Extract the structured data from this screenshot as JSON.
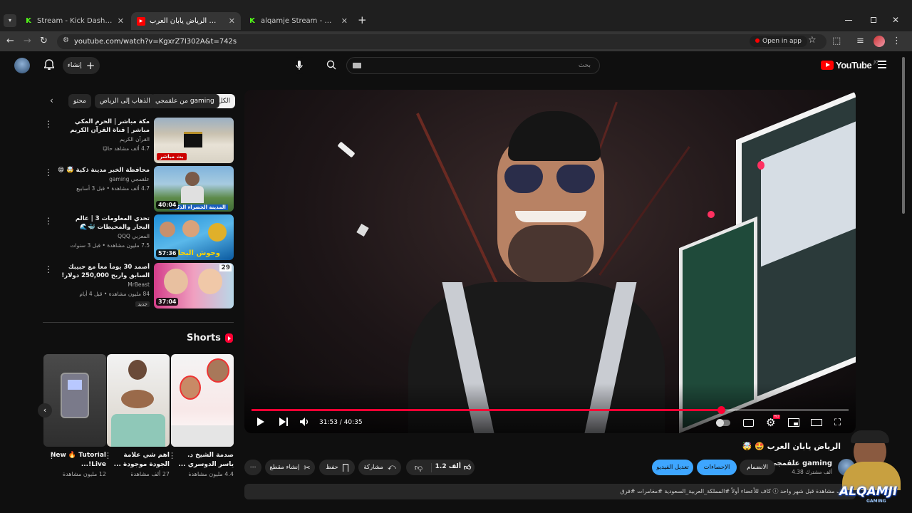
{
  "browser": {
    "tabs": [
      {
        "title": "Stream - Kick Dashboard",
        "favicon": "K",
        "color": "#53fc18",
        "active": false
      },
      {
        "title": "الرياض يابان العرب 🤩 🤯 - YouTube",
        "favicon": "▶",
        "color": "#ff0000",
        "active": true
      },
      {
        "title": "alqamje Stream - Watch Live o",
        "favicon": "K",
        "color": "#53fc18",
        "active": false
      }
    ],
    "new_tab": "+",
    "url": "youtube.com/watch?v=KgxrZ7I302A&t=742s",
    "open_in_app": "Open in app"
  },
  "header": {
    "create_label": "إنشاء",
    "search_placeholder": "بحث",
    "logo_text": "YouTube",
    "logo_sup": "JO"
  },
  "chips": [
    "الكل",
    "من علقمجي gaming",
    "الذهاب إلى الرياض",
    "محتو"
  ],
  "recommended": [
    {
      "title": "مكة مباشر | الحرم المكي مباشر | قناة القرآن الكريم السعودية | Makkah Live",
      "channel": "القرآن الكريم",
      "meta": "4.7 ألف مشاهد حاليًا",
      "badge": "بث مباشر",
      "duration": ""
    },
    {
      "title": "محافظة الخبر مدينة ذكية 🤯 😁",
      "channel": "علقمجي gaming",
      "meta": "4.7 ألف مشاهدة • قبل 3 أسابيع",
      "badge": "",
      "duration": "40:04",
      "overlay": "المدينة الخضراء الذكية"
    },
    {
      "title": "تحدي المعلومات 3 | عالم البحار والمحيطات 🐳🌊",
      "channel": "المعزبي QQQ",
      "meta": "7.5 مليون مشاهدة • قبل 3 سنوات",
      "badge": "",
      "duration": "57:36",
      "overlay": "وحوش البحار"
    },
    {
      "title": "أصمد 30 يوماً معاً مع حبيبك السابق واربح 250,000 دولار!",
      "channel": "MrBeast",
      "meta": "84 مليون مشاهدة • قبل 4 أيام",
      "badge": "جديد",
      "duration": "37:04",
      "overlay": "29"
    }
  ],
  "shorts": {
    "heading": "Shorts",
    "items": [
      {
        "title": "صدمة الشيخ د. ياسر الدوسري ...",
        "views": "4.4 مليون مشاهدة"
      },
      {
        "title": "اهم شي علامة الجودة موجودة ...",
        "views": "27 ألف مشاهدة"
      },
      {
        "title": "New 🔥 Tutorial Live!...",
        "views": "12 مليون مشاهدة"
      }
    ]
  },
  "player": {
    "time": "31:53 / 40:35",
    "progress": 0.786,
    "hd_badge": "HD"
  },
  "video": {
    "title": "الرياض يابان العرب 🤩 🤯",
    "channel": "علقمجي gaming",
    "subscribers": "4.38 ألف مشترك",
    "join": "الانضمام",
    "stats": "الإحصاءات",
    "edit": "تعديل الفيديو",
    "likes": "1.2 ألف",
    "share": "مشاركة",
    "save": "حفظ",
    "clip": "إنشاء مقطع",
    "description": "ألف مشاهدة  قبل شهر واحد  ⓘ كاف للأعضاء أولاً  #المملكة_العربية_السعودية #مغامرات #فرق"
  },
  "watermark": {
    "text": "ALQAMJI",
    "sub": "GAMING"
  },
  "colors": {
    "accent": "#ff0033",
    "blue": "#3ea6ff",
    "kick": "#53fc18"
  }
}
